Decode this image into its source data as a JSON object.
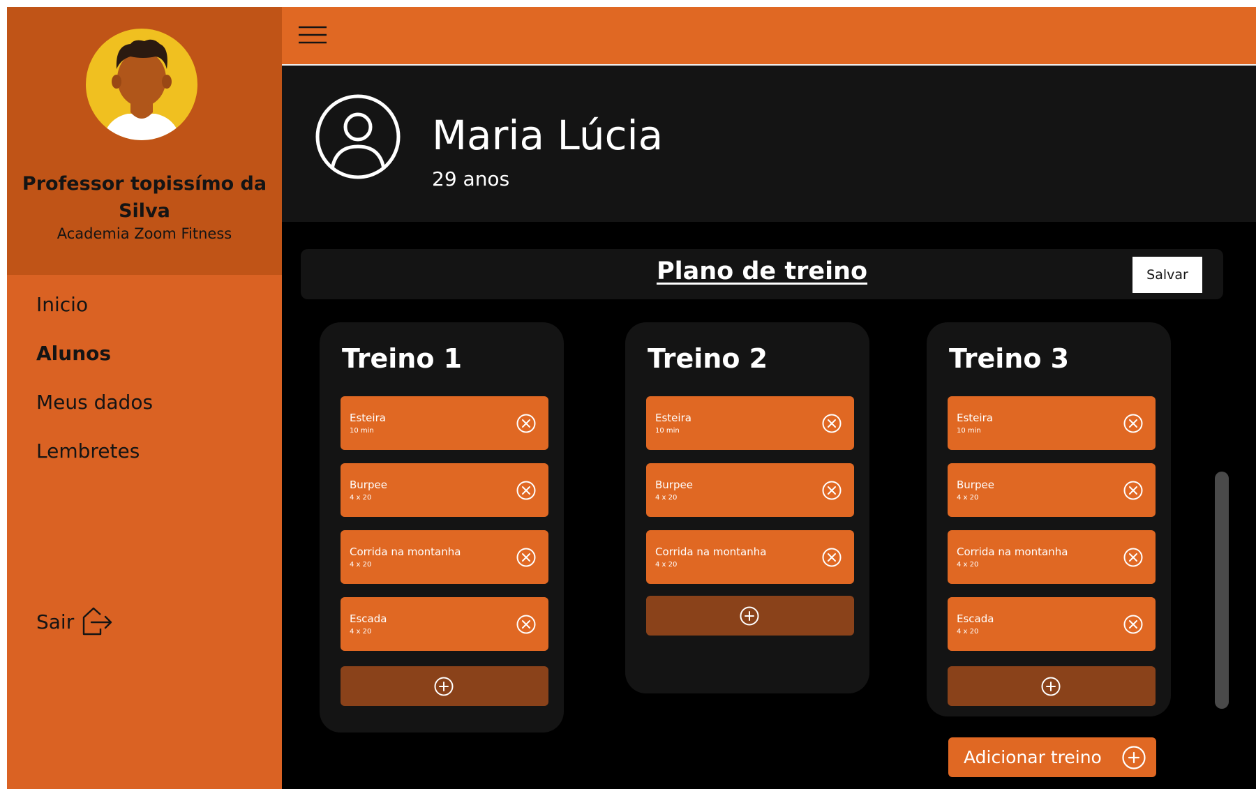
{
  "sidebar": {
    "profile": {
      "name": "Professor topissímo da Silva",
      "gym": "Academia Zoom Fitness"
    },
    "nav": [
      {
        "label": "Inicio",
        "active": false
      },
      {
        "label": "Alunos",
        "active": true
      },
      {
        "label": "Meus dados",
        "active": false
      },
      {
        "label": "Lembretes",
        "active": false
      }
    ],
    "logout_label": "Sair"
  },
  "student": {
    "name": "Maria Lúcia",
    "age": "29 anos"
  },
  "plan": {
    "title": "Plano de treino",
    "save_label": "Salvar"
  },
  "workouts": [
    {
      "title": "Treino 1",
      "exercises": [
        {
          "name": "Esteira",
          "detail": "10 min"
        },
        {
          "name": "Burpee",
          "detail": "4 x 20"
        },
        {
          "name": "Corrida na montanha",
          "detail": "4 x 20"
        },
        {
          "name": "Escada",
          "detail": "4 x 20"
        }
      ]
    },
    {
      "title": "Treino 2",
      "exercises": [
        {
          "name": "Esteira",
          "detail": "10 min"
        },
        {
          "name": "Burpee",
          "detail": "4 x 20"
        },
        {
          "name": "Corrida na montanha",
          "detail": "4 x 20"
        }
      ]
    },
    {
      "title": "Treino 3",
      "exercises": [
        {
          "name": "Esteira",
          "detail": "10 min"
        },
        {
          "name": "Burpee",
          "detail": "4 x 20"
        },
        {
          "name": "Corrida na montanha",
          "detail": "4 x 20"
        },
        {
          "name": "Escada",
          "detail": "4 x 20"
        }
      ]
    }
  ],
  "add_training_label": "Adicionar treino",
  "icons": {
    "menu": "hamburger-menu-icon",
    "student": "user-circle-icon",
    "remove": "close-circle-icon",
    "add": "plus-circle-icon",
    "logout": "logout-icon"
  },
  "colors": {
    "sidebar": "#DA6223",
    "profile_bg": "#C05417",
    "topbar": "#E06823",
    "exercise_card": "#E06823",
    "add_button": "#8A421A",
    "panel": "#141414",
    "background": "#000000"
  }
}
